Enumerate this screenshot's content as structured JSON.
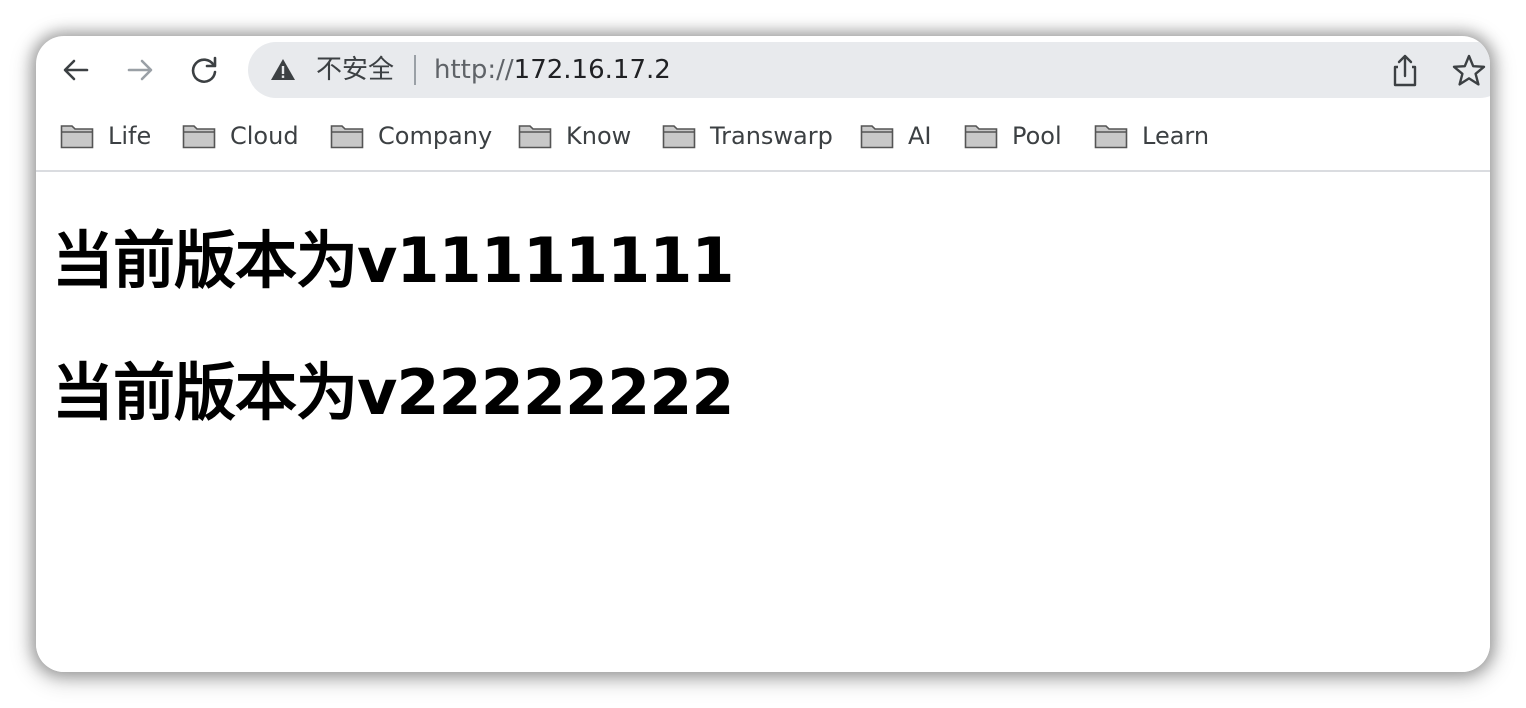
{
  "browser": {
    "nav": {
      "back_icon": "arrow-left-icon",
      "forward_icon": "arrow-right-icon",
      "reload_icon": "reload-icon"
    },
    "omnibox": {
      "security_icon": "warning-triangle-icon",
      "security_label": "不安全",
      "url_scheme": "http://",
      "url_host": "172.16.17.2"
    },
    "actions": {
      "share_icon": "share-icon",
      "bookmark_icon": "star-icon"
    },
    "bookmarks": [
      {
        "label": "Life",
        "icon": "folder-icon"
      },
      {
        "label": "Cloud",
        "icon": "folder-icon"
      },
      {
        "label": "Company",
        "icon": "folder-icon"
      },
      {
        "label": "Know",
        "icon": "folder-icon"
      },
      {
        "label": "Transwarp",
        "icon": "folder-icon"
      },
      {
        "label": "AI",
        "icon": "folder-icon"
      },
      {
        "label": "Pool",
        "icon": "folder-icon"
      },
      {
        "label": "Learn",
        "icon": "folder-icon"
      }
    ]
  },
  "page": {
    "headings": [
      "当前版本为v11111111",
      "当前版本为v22222222"
    ]
  },
  "colors": {
    "omnibox_bg": "#e8eaed",
    "text_primary": "#202124",
    "text_secondary": "#3c4043"
  }
}
